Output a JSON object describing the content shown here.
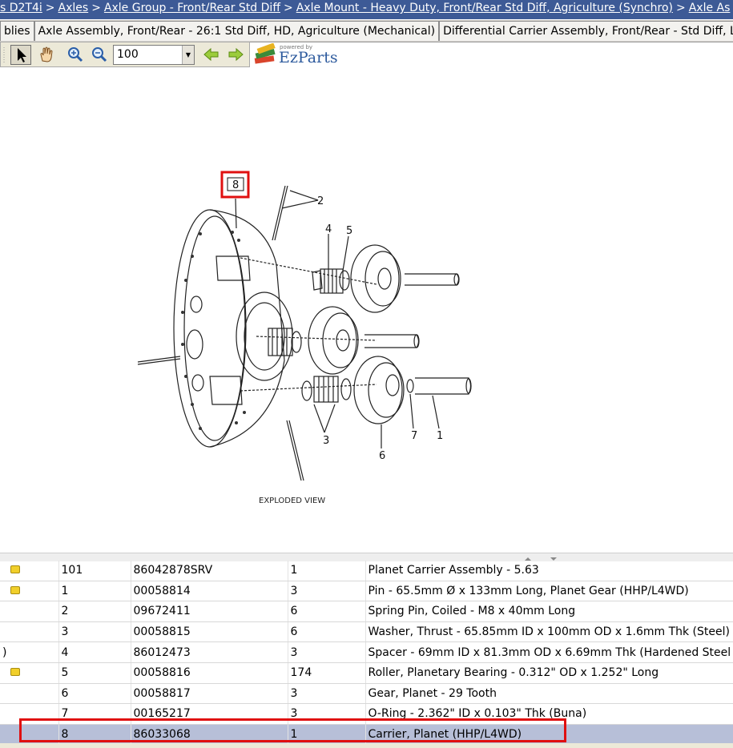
{
  "breadcrumb": {
    "lead": "s D2T4i",
    "items": [
      "Axles",
      "Axle Group - Front/Rear Std Diff",
      "Axle Mount - Heavy Duty, Front/Rear Std Diff, Agriculture (Synchro)",
      "Axle As"
    ],
    "separator": ">"
  },
  "tabs": [
    {
      "label": "blies"
    },
    {
      "label": "Axle Assembly, Front/Rear - 26:1 Std Diff, HD, Agriculture (Mechanical)"
    },
    {
      "label": "Differential Carrier Assembly, Front/Rear - Std Diff, LH"
    }
  ],
  "toolbar": {
    "zoom_value": "100",
    "tools": [
      "select-arrow-icon",
      "pan-hand-icon",
      "zoom-in-icon",
      "zoom-out-icon",
      "back-arrow-icon",
      "forward-arrow-icon"
    ]
  },
  "logo": {
    "powered": "powered by",
    "brand": "EzParts"
  },
  "diagram": {
    "caption": "EXPLODED VIEW",
    "callouts": [
      "8",
      "2",
      "4",
      "5",
      "3",
      "6",
      "7",
      "1"
    ],
    "highlight_color": "#e01010"
  },
  "parts": {
    "rows": [
      {
        "marker": "note",
        "ref": "101",
        "part": "86042878SRV",
        "qty": "1",
        "desc": "Planet Carrier Assembly - 5.63"
      },
      {
        "marker": "note",
        "ref": "1",
        "part": "00058814",
        "qty": "3",
        "desc": "Pin - 65.5mm Ø x 133mm Long, Planet Gear (HHP/L4WD)"
      },
      {
        "marker": "",
        "ref": "2",
        "part": "09672411",
        "qty": "6",
        "desc": "Spring Pin, Coiled - M8 x 40mm Long"
      },
      {
        "marker": "",
        "ref": "3",
        "part": "00058815",
        "qty": "6",
        "desc": "Washer, Thrust - 65.85mm ID x 100mm OD x 1.6mm Thk (Steel)"
      },
      {
        "marker": ")",
        "ref": "4",
        "part": "86012473",
        "qty": "3",
        "desc": "Spacer - 69mm ID x 81.3mm OD x 6.69mm Thk (Hardened Steel"
      },
      {
        "marker": "note",
        "ref": "5",
        "part": "00058816",
        "qty": "174",
        "desc": "Roller, Planetary Bearing - 0.312\" OD x 1.252\" Long"
      },
      {
        "marker": "",
        "ref": "6",
        "part": "00058817",
        "qty": "3",
        "desc": "Gear, Planet - 29 Tooth"
      },
      {
        "marker": "",
        "ref": "7",
        "part": "00165217",
        "qty": "3",
        "desc": "O-Ring - 2.362\" ID x 0.103\" Thk (Buna)"
      },
      {
        "marker": "",
        "ref": "8",
        "part": "86033068",
        "qty": "1",
        "desc": "Carrier, Planet (HHP/L4WD)",
        "selected": true
      }
    ]
  }
}
